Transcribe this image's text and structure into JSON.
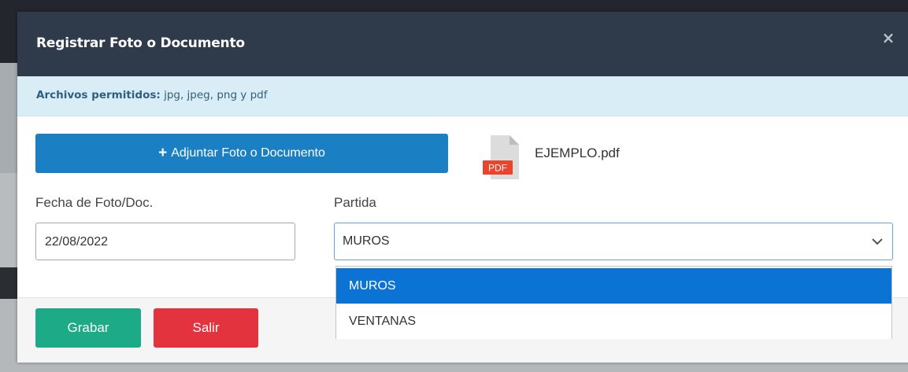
{
  "modal": {
    "title": "Registrar Foto o Documento",
    "close_symbol": "×",
    "info": {
      "label": "Archivos permitidos:",
      "text": " jpg, jpeg, png y pdf"
    },
    "attach_button": {
      "plus": "+",
      "label": "Adjuntar Foto o Documento"
    },
    "file": {
      "icon": "pdf-file-icon",
      "badge": "PDF",
      "name": "EJEMPLO.pdf"
    },
    "date_field": {
      "label": "Fecha de Foto/Doc.",
      "value": "22/08/2022"
    },
    "partida_field": {
      "label": "Partida",
      "value": "MUROS",
      "options": [
        "MUROS",
        "VENTANAS"
      ]
    },
    "footer": {
      "save_label": "Grabar",
      "exit_label": "Salir"
    }
  },
  "colors": {
    "header_bg": "#2f3a4a",
    "info_bg": "#d9edf7",
    "primary": "#1b7fc4",
    "success": "#1daa86",
    "danger": "#e2333f",
    "dropdown_selected": "#0b73d4",
    "pdf_badge": "#e8452c"
  }
}
